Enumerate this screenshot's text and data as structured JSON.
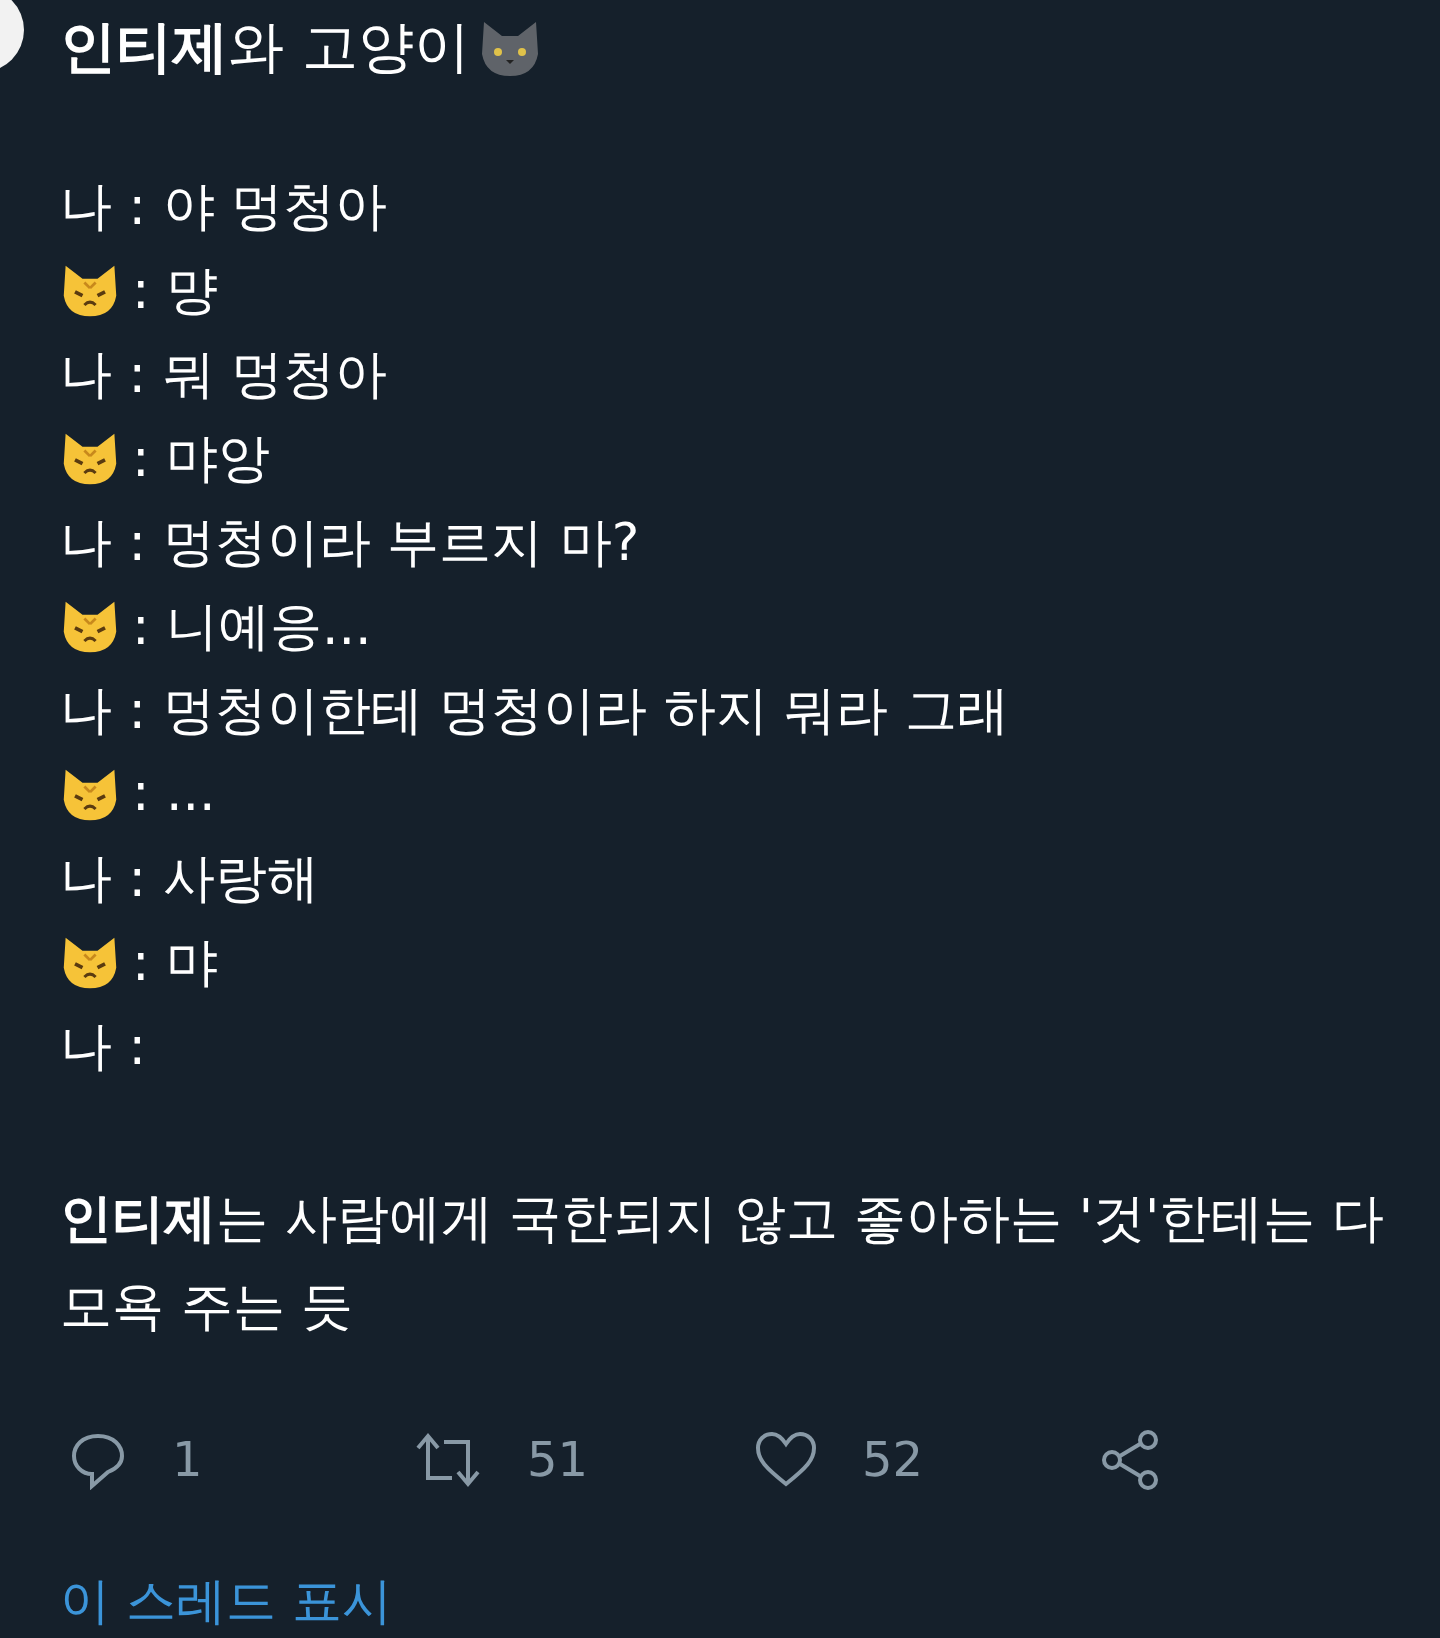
{
  "title": "**인티제**와 고양이",
  "lines": [
    {
      "kind": "me",
      "text": "나 : 야 멍청아"
    },
    {
      "kind": "cat",
      "text": ": 먕"
    },
    {
      "kind": "me",
      "text": "나 : 뭐 멍청아"
    },
    {
      "kind": "cat",
      "text": ": 먀앙"
    },
    {
      "kind": "me",
      "text": "나 : 멍청이라 부르지 마?"
    },
    {
      "kind": "cat",
      "text": ": 니예응..."
    },
    {
      "kind": "me",
      "text": "나 : 멍청이한테 멍청이라 하지 뭐라 그래"
    },
    {
      "kind": "cat",
      "text": ": ..."
    },
    {
      "kind": "me",
      "text": "나 : 사랑해"
    },
    {
      "kind": "cat",
      "text": ": 먀"
    },
    {
      "kind": "me",
      "text": "나 :"
    }
  ],
  "comment": "**인티제**는 사람에게 국한되지 않고 좋아하는 '것'한테는 다 모욕 주는 듯",
  "actions": [
    {
      "kind": "reply",
      "count": "1"
    },
    {
      "kind": "retweet",
      "count": "51"
    },
    {
      "kind": "like",
      "count": "52"
    },
    {
      "kind": "share"
    }
  ],
  "thread_link": "이 스레드 표시"
}
